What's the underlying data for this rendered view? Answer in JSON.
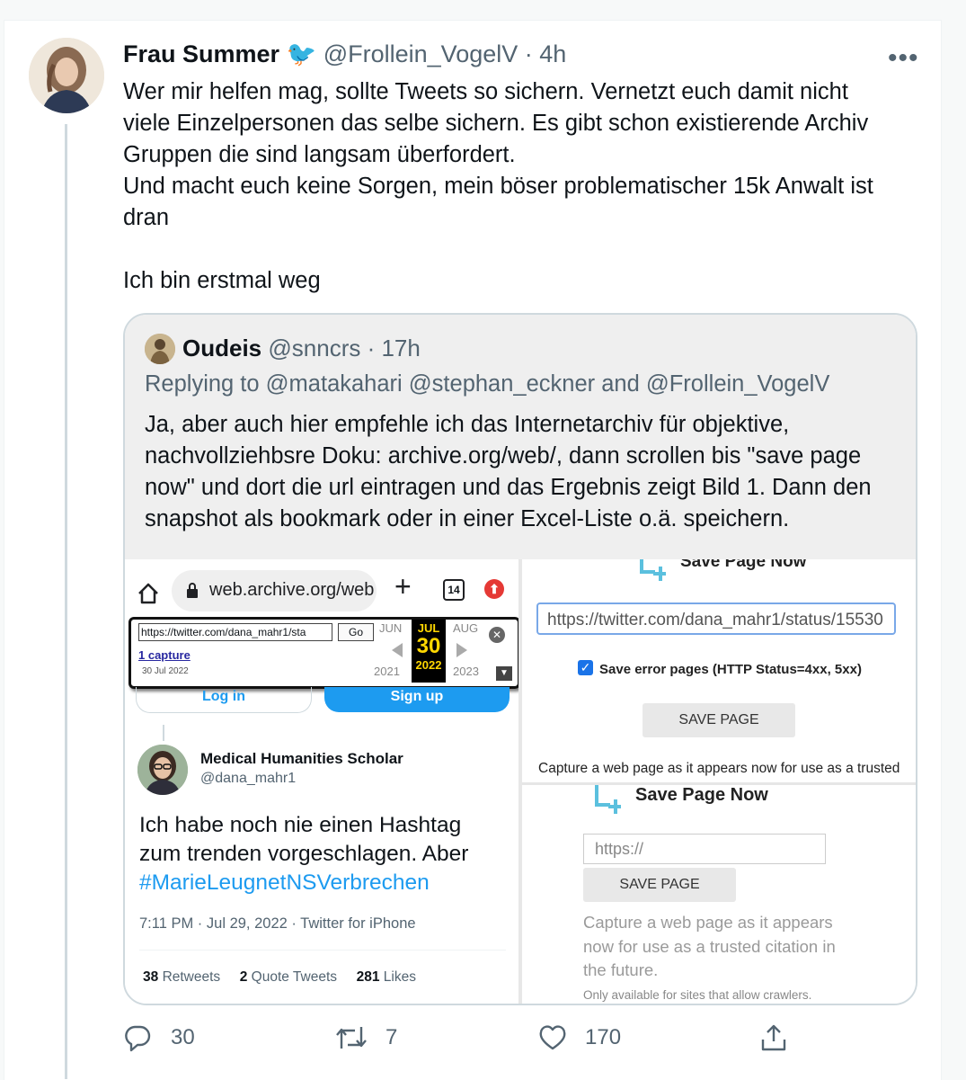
{
  "tweet": {
    "author_name": "Frau Summer",
    "author_emoji": "🐦",
    "handle": "@Frollein_VogelV",
    "time": "· 4h",
    "more_label": "•••",
    "text_lines": [
      "Wer mir helfen mag, sollte Tweets so sichern. Vernetzt euch damit nicht",
      "viele Einzelpersonen das selbe sichern. Es gibt schon existierende Archiv",
      "Gruppen die sind langsam überfordert.",
      "Und macht euch keine Sorgen, mein böser problematischer 15k Anwalt ist",
      "dran",
      "",
      "Ich bin erstmal weg"
    ],
    "actions": {
      "replies": "30",
      "retweets": "7",
      "likes": "170"
    }
  },
  "quote": {
    "author_name": "Oudeis",
    "handle": "@snncrs",
    "time": "· 17h",
    "replying_prefix": "Replying to",
    "replying_mentions": "@matakahari @stephan_eckner and @Frollein_VogelV",
    "text_lines": [
      "Ja, aber auch hier empfehle ich das Internetarchiv für objektive,",
      "nachvollziehbsre Doku: archive.org/web/, dann scrollen bis \"save page",
      "now\" und dort die url eintragen und das Ergebnis zeigt Bild 1. Dann den",
      "snapshot als bookmark oder in einer Excel-Liste o.ä. speichern."
    ]
  },
  "screenshot_left": {
    "browser_url": "web.archive.org/web",
    "tab_count": "14",
    "wayback": {
      "input_value": "https://twitter.com/dana_mahr1/sta",
      "go_label": "Go",
      "capture_link": "1 capture",
      "capture_date": "30 Jul 2022",
      "prev_month": "JUN",
      "active_month": "JUL",
      "next_month": "AUG",
      "active_day": "30",
      "prev_year": "2021",
      "active_year": "2022",
      "next_year": "2023"
    },
    "login_label": "Log in",
    "signup_label": "Sign up",
    "embedded_tweet": {
      "name": "Medical Humanities Scholar",
      "handle": "@dana_mahr1",
      "text_lines": [
        "Ich habe noch nie einen Hashtag",
        "zum trenden vorgeschlagen. Aber"
      ],
      "hashtag": "#MarieLeugnetNSVerbrechen",
      "meta": "7:11 PM · Jul 29, 2022 · Twitter for iPhone",
      "retweets_count": "38",
      "retweets_label": "Retweets",
      "quotes_count": "2",
      "quotes_label": "Quote Tweets",
      "likes_count": "281",
      "likes_label": "Likes"
    }
  },
  "screenshot_right_top": {
    "title": "Save Page Now",
    "url_value": "https://twitter.com/dana_mahr1/status/15530",
    "checkbox_label": "Save error pages (HTTP Status=4xx, 5xx)",
    "save_label": "SAVE PAGE",
    "caption": "Capture a web page as it appears now for use as a trusted"
  },
  "screenshot_right_bottom": {
    "title": "Save Page Now",
    "url_placeholder": "https://",
    "save_label": "SAVE PAGE",
    "caption_lines": [
      "Capture a web page as it appears",
      "now for use as a trusted citation in",
      "the future."
    ],
    "note": "Only available for sites that allow crawlers."
  },
  "colors": {
    "link_blue": "#1d9bf0",
    "secondary_text": "#536471",
    "quote_bg": "#efefef",
    "archive_teal": "#5bc0de"
  }
}
